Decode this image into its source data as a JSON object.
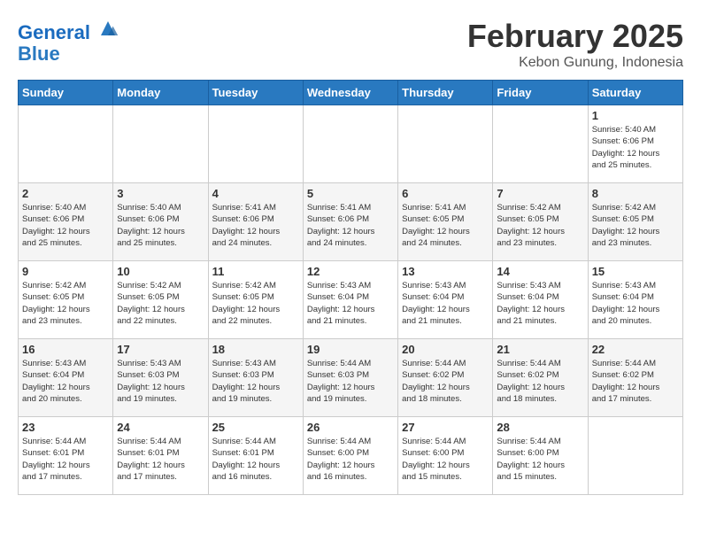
{
  "header": {
    "logo_line1": "General",
    "logo_line2": "Blue",
    "title": "February 2025",
    "subtitle": "Kebon Gunung, Indonesia"
  },
  "weekdays": [
    "Sunday",
    "Monday",
    "Tuesday",
    "Wednesday",
    "Thursday",
    "Friday",
    "Saturday"
  ],
  "weeks": [
    [
      {
        "day": "",
        "info": ""
      },
      {
        "day": "",
        "info": ""
      },
      {
        "day": "",
        "info": ""
      },
      {
        "day": "",
        "info": ""
      },
      {
        "day": "",
        "info": ""
      },
      {
        "day": "",
        "info": ""
      },
      {
        "day": "1",
        "info": "Sunrise: 5:40 AM\nSunset: 6:06 PM\nDaylight: 12 hours\nand 25 minutes."
      }
    ],
    [
      {
        "day": "2",
        "info": "Sunrise: 5:40 AM\nSunset: 6:06 PM\nDaylight: 12 hours\nand 25 minutes."
      },
      {
        "day": "3",
        "info": "Sunrise: 5:40 AM\nSunset: 6:06 PM\nDaylight: 12 hours\nand 25 minutes."
      },
      {
        "day": "4",
        "info": "Sunrise: 5:41 AM\nSunset: 6:06 PM\nDaylight: 12 hours\nand 24 minutes."
      },
      {
        "day": "5",
        "info": "Sunrise: 5:41 AM\nSunset: 6:06 PM\nDaylight: 12 hours\nand 24 minutes."
      },
      {
        "day": "6",
        "info": "Sunrise: 5:41 AM\nSunset: 6:05 PM\nDaylight: 12 hours\nand 24 minutes."
      },
      {
        "day": "7",
        "info": "Sunrise: 5:42 AM\nSunset: 6:05 PM\nDaylight: 12 hours\nand 23 minutes."
      },
      {
        "day": "8",
        "info": "Sunrise: 5:42 AM\nSunset: 6:05 PM\nDaylight: 12 hours\nand 23 minutes."
      }
    ],
    [
      {
        "day": "9",
        "info": "Sunrise: 5:42 AM\nSunset: 6:05 PM\nDaylight: 12 hours\nand 23 minutes."
      },
      {
        "day": "10",
        "info": "Sunrise: 5:42 AM\nSunset: 6:05 PM\nDaylight: 12 hours\nand 22 minutes."
      },
      {
        "day": "11",
        "info": "Sunrise: 5:42 AM\nSunset: 6:05 PM\nDaylight: 12 hours\nand 22 minutes."
      },
      {
        "day": "12",
        "info": "Sunrise: 5:43 AM\nSunset: 6:04 PM\nDaylight: 12 hours\nand 21 minutes."
      },
      {
        "day": "13",
        "info": "Sunrise: 5:43 AM\nSunset: 6:04 PM\nDaylight: 12 hours\nand 21 minutes."
      },
      {
        "day": "14",
        "info": "Sunrise: 5:43 AM\nSunset: 6:04 PM\nDaylight: 12 hours\nand 21 minutes."
      },
      {
        "day": "15",
        "info": "Sunrise: 5:43 AM\nSunset: 6:04 PM\nDaylight: 12 hours\nand 20 minutes."
      }
    ],
    [
      {
        "day": "16",
        "info": "Sunrise: 5:43 AM\nSunset: 6:04 PM\nDaylight: 12 hours\nand 20 minutes."
      },
      {
        "day": "17",
        "info": "Sunrise: 5:43 AM\nSunset: 6:03 PM\nDaylight: 12 hours\nand 19 minutes."
      },
      {
        "day": "18",
        "info": "Sunrise: 5:43 AM\nSunset: 6:03 PM\nDaylight: 12 hours\nand 19 minutes."
      },
      {
        "day": "19",
        "info": "Sunrise: 5:44 AM\nSunset: 6:03 PM\nDaylight: 12 hours\nand 19 minutes."
      },
      {
        "day": "20",
        "info": "Sunrise: 5:44 AM\nSunset: 6:02 PM\nDaylight: 12 hours\nand 18 minutes."
      },
      {
        "day": "21",
        "info": "Sunrise: 5:44 AM\nSunset: 6:02 PM\nDaylight: 12 hours\nand 18 minutes."
      },
      {
        "day": "22",
        "info": "Sunrise: 5:44 AM\nSunset: 6:02 PM\nDaylight: 12 hours\nand 17 minutes."
      }
    ],
    [
      {
        "day": "23",
        "info": "Sunrise: 5:44 AM\nSunset: 6:01 PM\nDaylight: 12 hours\nand 17 minutes."
      },
      {
        "day": "24",
        "info": "Sunrise: 5:44 AM\nSunset: 6:01 PM\nDaylight: 12 hours\nand 17 minutes."
      },
      {
        "day": "25",
        "info": "Sunrise: 5:44 AM\nSunset: 6:01 PM\nDaylight: 12 hours\nand 16 minutes."
      },
      {
        "day": "26",
        "info": "Sunrise: 5:44 AM\nSunset: 6:00 PM\nDaylight: 12 hours\nand 16 minutes."
      },
      {
        "day": "27",
        "info": "Sunrise: 5:44 AM\nSunset: 6:00 PM\nDaylight: 12 hours\nand 15 minutes."
      },
      {
        "day": "28",
        "info": "Sunrise: 5:44 AM\nSunset: 6:00 PM\nDaylight: 12 hours\nand 15 minutes."
      },
      {
        "day": "",
        "info": ""
      }
    ]
  ]
}
